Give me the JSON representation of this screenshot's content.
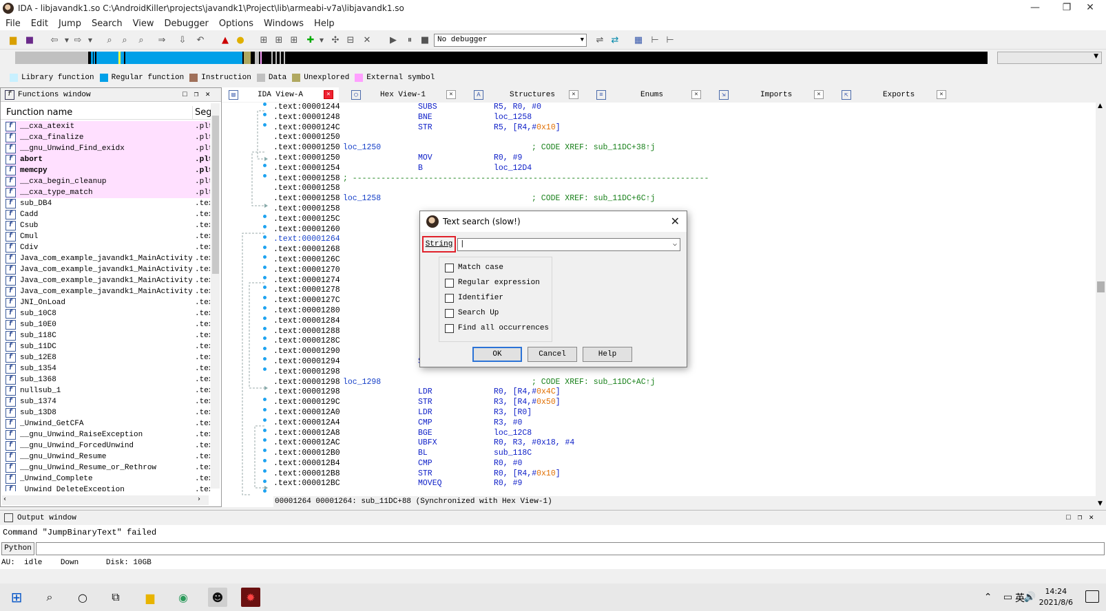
{
  "window": {
    "title": "IDA - libjavandk1.so C:\\AndroidKiller\\projects\\javandk1\\Project\\lib\\armeabi-v7a\\libjavandk1.so",
    "min": "—",
    "max": "❐",
    "close": "✕"
  },
  "menu": [
    "File",
    "Edit",
    "Jump",
    "Search",
    "View",
    "Debugger",
    "Options",
    "Windows",
    "Help"
  ],
  "toolbar": {
    "debugger_value": "No debugger"
  },
  "legend": [
    {
      "label": "Library function",
      "color": "#c8f0ff"
    },
    {
      "label": "Regular function",
      "color": "#00a0e8"
    },
    {
      "label": "Instruction",
      "color": "#a0705a"
    },
    {
      "label": "Data",
      "color": "#c0c0c0"
    },
    {
      "label": "Unexplored",
      "color": "#b0a860"
    },
    {
      "label": "External symbol",
      "color": "#ffa0ff"
    }
  ],
  "functions_window": {
    "title": "Functions window",
    "col_name": "Function name",
    "col_seg": "Seg",
    "items": [
      {
        "name": "__cxa_atexit",
        "seg": ".plt",
        "lib": true
      },
      {
        "name": "__cxa_finalize",
        "seg": ".plt",
        "lib": true
      },
      {
        "name": "__gnu_Unwind_Find_exidx",
        "seg": ".plt",
        "lib": true
      },
      {
        "name": "abort",
        "seg": ".plt",
        "lib": true,
        "bold": true
      },
      {
        "name": "memcpy",
        "seg": ".plt",
        "lib": true,
        "bold": true
      },
      {
        "name": "__cxa_begin_cleanup",
        "seg": ".plt",
        "lib": true
      },
      {
        "name": "__cxa_type_match",
        "seg": ".plt",
        "lib": true
      },
      {
        "name": "sub_DB4",
        "seg": ".tex"
      },
      {
        "name": "Cadd",
        "seg": ".tex"
      },
      {
        "name": "Csub",
        "seg": ".tex"
      },
      {
        "name": "Cmul",
        "seg": ".tex"
      },
      {
        "name": "Cdiv",
        "seg": ".tex"
      },
      {
        "name": "Java_com_example_javandk1_MainActivity…",
        "seg": ".tex"
      },
      {
        "name": "Java_com_example_javandk1_MainActivity…",
        "seg": ".tex"
      },
      {
        "name": "Java_com_example_javandk1_MainActivity…",
        "seg": ".tex"
      },
      {
        "name": "Java_com_example_javandk1_MainActivity…",
        "seg": ".tex"
      },
      {
        "name": "JNI_OnLoad",
        "seg": ".tex"
      },
      {
        "name": "sub_10C8",
        "seg": ".tex"
      },
      {
        "name": "sub_10E0",
        "seg": ".tex"
      },
      {
        "name": "sub_118C",
        "seg": ".tex"
      },
      {
        "name": "sub_11DC",
        "seg": ".tex"
      },
      {
        "name": "sub_12E8",
        "seg": ".tex"
      },
      {
        "name": "sub_1354",
        "seg": ".tex"
      },
      {
        "name": "sub_1368",
        "seg": ".tex"
      },
      {
        "name": "nullsub_1",
        "seg": ".tex"
      },
      {
        "name": "sub_1374",
        "seg": ".tex"
      },
      {
        "name": "sub_13D8",
        "seg": ".tex"
      },
      {
        "name": "_Unwind_GetCFA",
        "seg": ".tex"
      },
      {
        "name": "__gnu_Unwind_RaiseException",
        "seg": ".tex"
      },
      {
        "name": "__gnu_Unwind_ForcedUnwind",
        "seg": ".tex"
      },
      {
        "name": "__gnu_Unwind_Resume",
        "seg": ".tex"
      },
      {
        "name": "__gnu_Unwind_Resume_or_Rethrow",
        "seg": ".tex"
      },
      {
        "name": "_Unwind_Complete",
        "seg": ".tex"
      },
      {
        "name": "_Unwind_DeleteException",
        "seg": ".tex"
      }
    ]
  },
  "tabs": [
    {
      "label": "IDA View-A",
      "active": true
    },
    {
      "label": "Hex View-1"
    },
    {
      "label": "Structures"
    },
    {
      "label": "Enums"
    },
    {
      "label": "Imports"
    },
    {
      "label": "Exports"
    }
  ],
  "code_lines": [
    {
      "addr": ".text:00001244",
      "mn": "SUBS",
      "op": "R5, R0, #0"
    },
    {
      "addr": ".text:00001248",
      "mn": "BNE",
      "op": "loc_1258"
    },
    {
      "addr": ".text:0000124C",
      "mn": "STR",
      "op": "R5, [R4,#",
      "num": "0x10",
      "op2": "]"
    },
    {
      "addr": ".text:00001250"
    },
    {
      "addr": ".text:00001250",
      "label": "loc_1250",
      "cm": "; CODE XREF: sub_11DC+38↑j"
    },
    {
      "addr": ".text:00001250",
      "mn": "MOV",
      "op": "R0, #9"
    },
    {
      "addr": ".text:00001254",
      "mn": "B",
      "op": "loc_12D4"
    },
    {
      "addr": ".text:00001258",
      "sep": "; ---------------------------------------------------------------------------"
    },
    {
      "addr": ".text:00001258"
    },
    {
      "addr": ".text:00001258",
      "label": "loc_1258",
      "cm": "; CODE XREF: sub_11DC+6C↑j"
    },
    {
      "addr": ".text:00001258"
    },
    {
      "addr": ".text:0000125C"
    },
    {
      "addr": ".text:00001260"
    },
    {
      "addr": ".text:00001264",
      "hl": true
    },
    {
      "addr": ".text:00001268"
    },
    {
      "addr": ".text:0000126C"
    },
    {
      "addr": ".text:00001270"
    },
    {
      "addr": ".text:00001274"
    },
    {
      "addr": ".text:00001278"
    },
    {
      "addr": ".text:0000127C"
    },
    {
      "addr": ".text:00001280"
    },
    {
      "addr": ".text:00001284"
    },
    {
      "addr": ".text:00001288"
    },
    {
      "addr": ".text:0000128C"
    },
    {
      "addr": ".text:00001290"
    },
    {
      "addr": ".text:00001294",
      "mn": "STR",
      "op": "R0, [R4,#",
      "num": "0x4C",
      "op2": "]"
    },
    {
      "addr": ".text:00001298"
    },
    {
      "addr": ".text:00001298",
      "label": "loc_1298",
      "cm": "; CODE XREF: sub_11DC+AC↑j"
    },
    {
      "addr": ".text:00001298",
      "mn": "LDR",
      "op": "R0, [R4,#",
      "num": "0x4C",
      "op2": "]"
    },
    {
      "addr": ".text:0000129C",
      "mn": "STR",
      "op": "R3, [R4,#",
      "num": "0x50",
      "op2": "]"
    },
    {
      "addr": ".text:000012A0",
      "mn": "LDR",
      "op": "R3, [R0]"
    },
    {
      "addr": ".text:000012A4",
      "mn": "CMP",
      "op": "R3, #0"
    },
    {
      "addr": ".text:000012A8",
      "mn": "BGE",
      "op": "loc_12C8"
    },
    {
      "addr": ".text:000012AC",
      "mn": "UBFX",
      "op": "R0, R3, #0x18, #4"
    },
    {
      "addr": ".text:000012B0",
      "mn": "BL",
      "op": "sub_118C"
    },
    {
      "addr": ".text:000012B4",
      "mn": "CMP",
      "op": "R0, #0"
    },
    {
      "addr": ".text:000012B8",
      "mn": "STR",
      "op": "R0, [R4,#",
      "num": "0x10",
      "op2": "]"
    },
    {
      "addr": ".text:000012BC",
      "mn": "MOVEQ",
      "op": "R0, #9"
    }
  ],
  "code_status": "00001264 00001264: sub_11DC+88 (Synchronized with Hex View-1)",
  "output": {
    "title": "Output window",
    "message": "Command \"JumpBinaryText\" failed",
    "python_btn": "Python",
    "status": "AU:  idle    Down      Disk: 10GB"
  },
  "dialog": {
    "title": "Text search (slow!)",
    "string_label": "String",
    "input_value": "|",
    "options": [
      "Match case",
      "Regular expression",
      "Identifier",
      "Search Up",
      "Find all occurrences"
    ],
    "ok": "OK",
    "cancel": "Cancel",
    "help": "Help"
  },
  "taskbar": {
    "time": "14:24",
    "date": "2021/8/6",
    "ime": "英"
  }
}
